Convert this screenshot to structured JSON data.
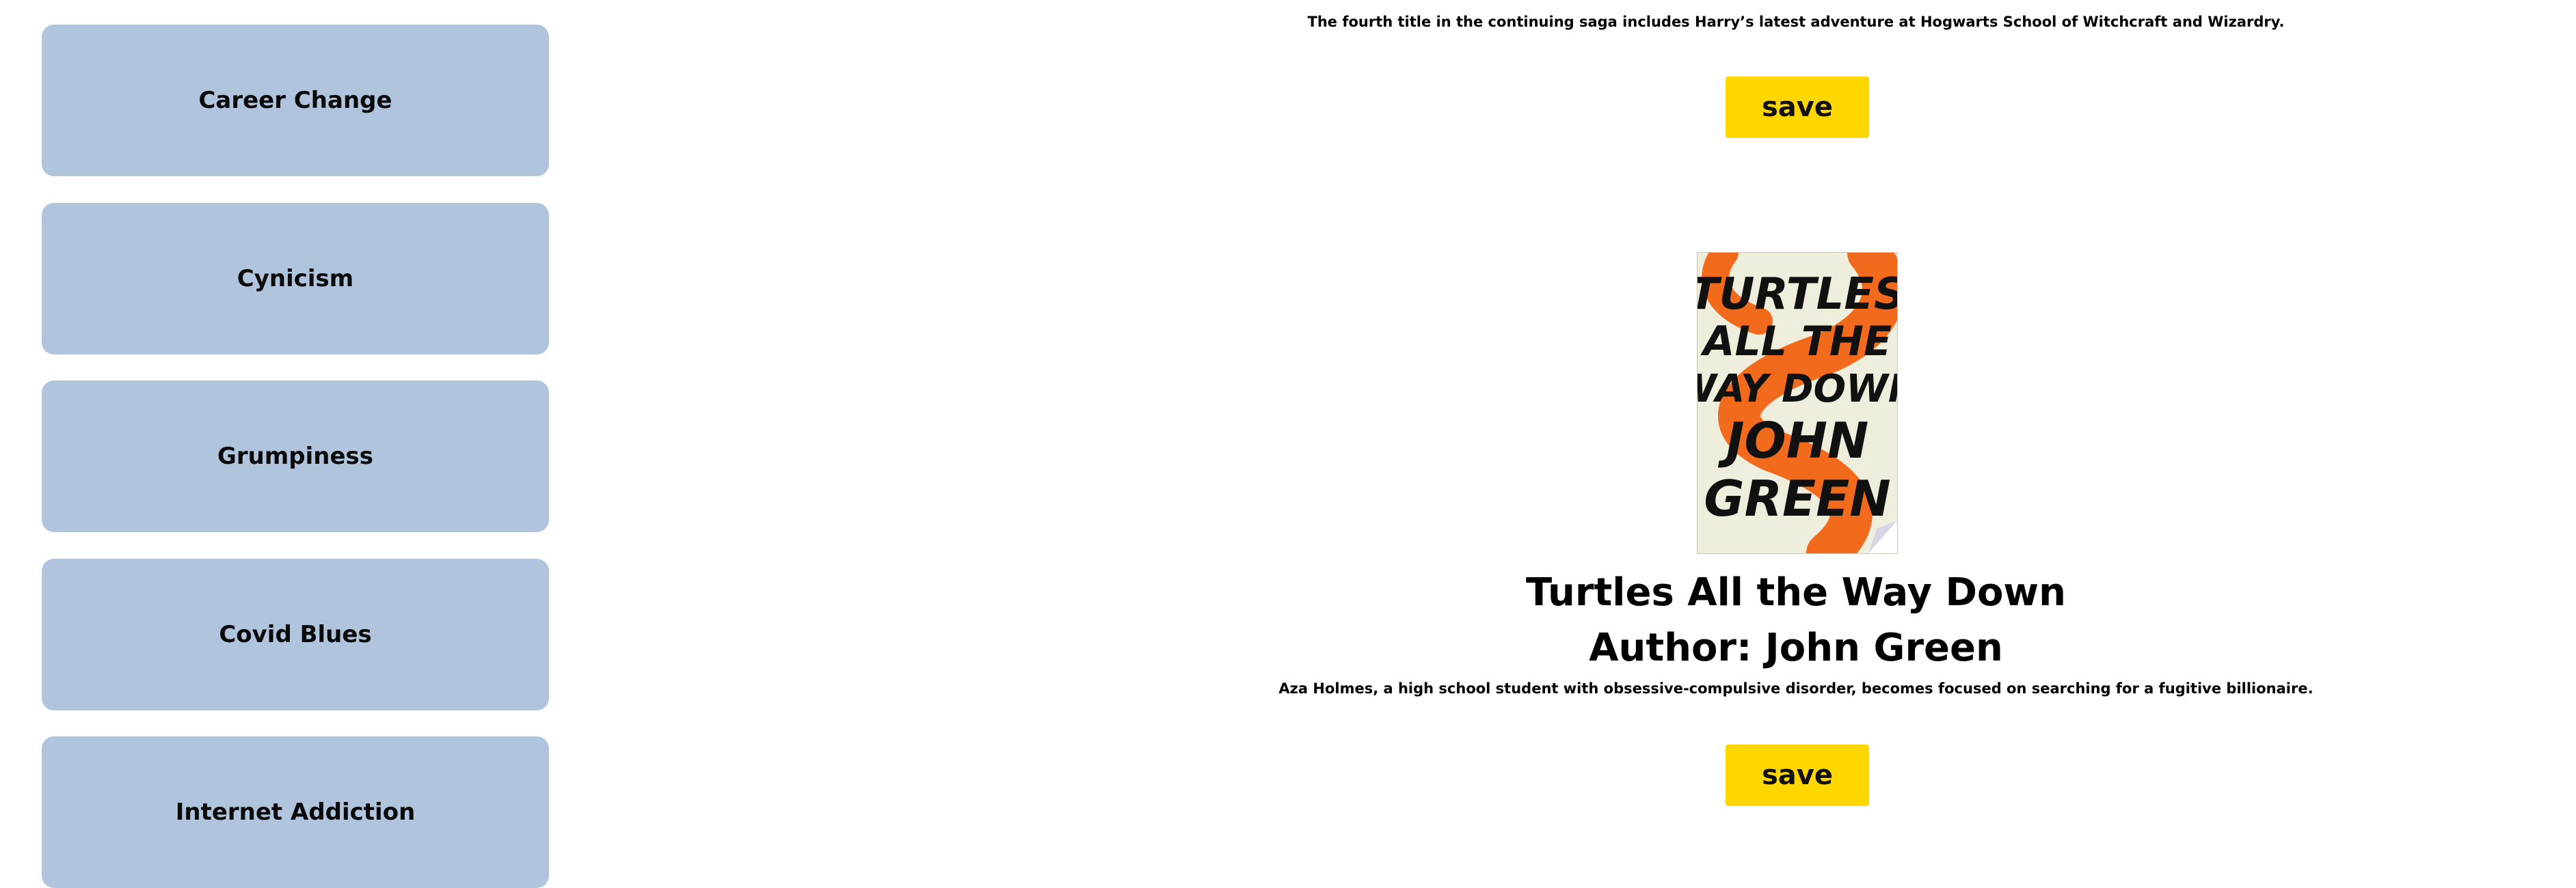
{
  "sidebar": {
    "items": [
      {
        "label": "Career Change"
      },
      {
        "label": "Cynicism"
      },
      {
        "label": "Grumpiness"
      },
      {
        "label": "Covid Blues"
      },
      {
        "label": "Internet Addiction"
      }
    ]
  },
  "books": [
    {
      "description": "The fourth title in the continuing saga includes Harry’s latest adventure at Hogwarts School of Witchcraft and Wizardry.",
      "save_label": "save"
    },
    {
      "title": "Turtles All the Way Down",
      "author": "Author: John Green",
      "description": "Aza Holmes, a high school student with obsessive-compulsive disorder, becomes focused on searching for a fugitive billionaire.",
      "save_label": "save",
      "cover": {
        "lines": [
          "TURTLES",
          "ALL THE",
          "WAY DOWN",
          "JOHN",
          "GREEN"
        ],
        "accent_color": "#f26a1b",
        "background_color": "#efeedd"
      }
    }
  ],
  "colors": {
    "sidebar_button": "#b0c4de",
    "save_button": "#ffd700"
  }
}
